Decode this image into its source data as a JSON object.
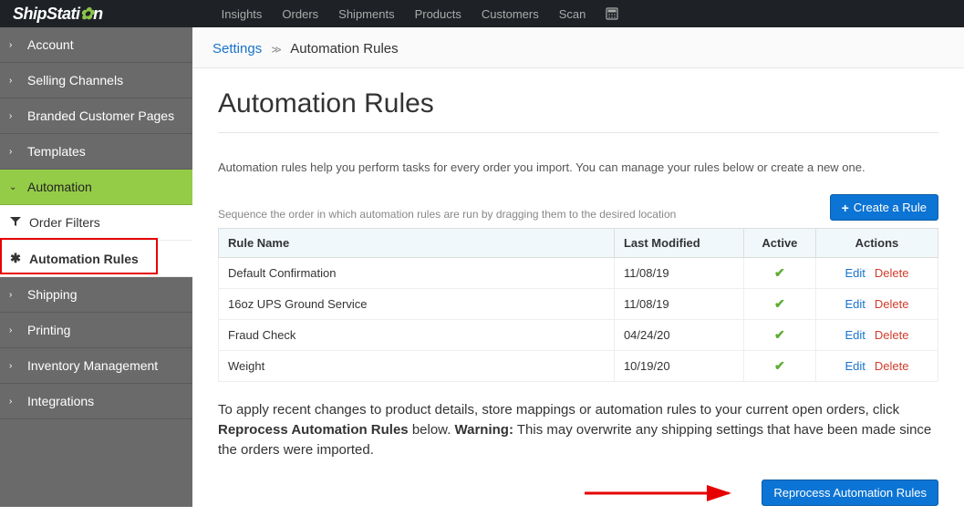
{
  "brand": {
    "name": "ShipStati",
    "gear": "✿",
    "suffix": "n"
  },
  "topnav": [
    "Insights",
    "Orders",
    "Shipments",
    "Products",
    "Customers",
    "Scan"
  ],
  "sidebar": {
    "items": [
      {
        "label": "Account"
      },
      {
        "label": "Selling Channels"
      },
      {
        "label": "Branded Customer Pages"
      },
      {
        "label": "Templates"
      },
      {
        "label": "Automation",
        "active": true
      },
      {
        "label": "Shipping"
      },
      {
        "label": "Printing"
      },
      {
        "label": "Inventory Management"
      },
      {
        "label": "Integrations"
      }
    ],
    "subs": [
      {
        "icon": "filter",
        "label": "Order Filters"
      },
      {
        "icon": "gear",
        "label": "Automation Rules",
        "selected": true
      }
    ]
  },
  "breadcrumb": {
    "root": "Settings",
    "current": "Automation Rules"
  },
  "page": {
    "title": "Automation Rules",
    "help": "Automation rules help you perform tasks for every order you import. You can manage your rules below or create a new one.",
    "seq": "Sequence the order in which automation rules are run by dragging them to the desired location",
    "create_btn": "Create a Rule",
    "reprocess_btn": "Reprocess Automation Rules",
    "apply_pre": "To apply recent changes to product details, store mappings or automation rules to your current open orders, click ",
    "apply_bold": "Reprocess Automation Rules",
    "apply_mid": " below. ",
    "apply_warn": "Warning:",
    "apply_post": " This may overwrite any shipping settings that have been made since the orders were imported."
  },
  "table": {
    "headers": {
      "name": "Rule Name",
      "modified": "Last Modified",
      "active": "Active",
      "actions": "Actions"
    },
    "action_labels": {
      "edit": "Edit",
      "delete": "Delete"
    },
    "rows": [
      {
        "name": "Default Confirmation",
        "modified": "11/08/19",
        "active": true
      },
      {
        "name": "16oz UPS Ground Service",
        "modified": "11/08/19",
        "active": true
      },
      {
        "name": "Fraud Check",
        "modified": "04/24/20",
        "active": true
      },
      {
        "name": "Weight",
        "modified": "10/19/20",
        "active": true
      }
    ]
  }
}
